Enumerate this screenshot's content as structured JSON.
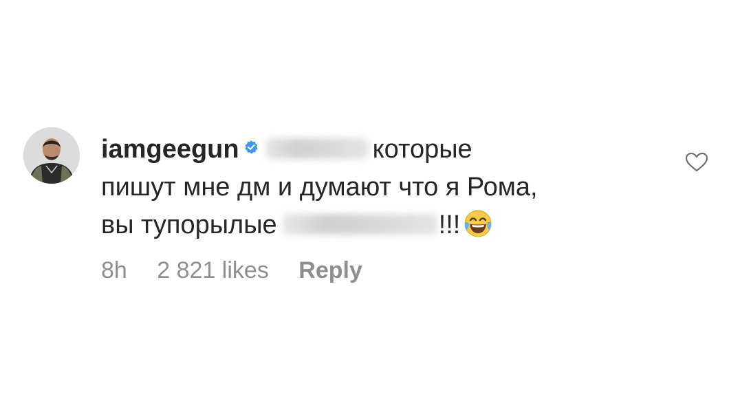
{
  "comment": {
    "username": "iamgeegun",
    "verified_icon": "verified-badge-icon",
    "text_part1": "которые",
    "text_line2": "пишут мне дм и думают что я Рома,",
    "text_line3_start": "вы тупорылые",
    "text_line3_end": "!!!",
    "emoji": "face-with-tears-of-joy-icon",
    "time": "8h",
    "likes": "2 821 likes",
    "reply_label": "Reply",
    "like_icon": "heart-outline-icon"
  },
  "colors": {
    "text": "#262626",
    "secondary": "#8e8e8e",
    "verified": "#3897f0"
  }
}
